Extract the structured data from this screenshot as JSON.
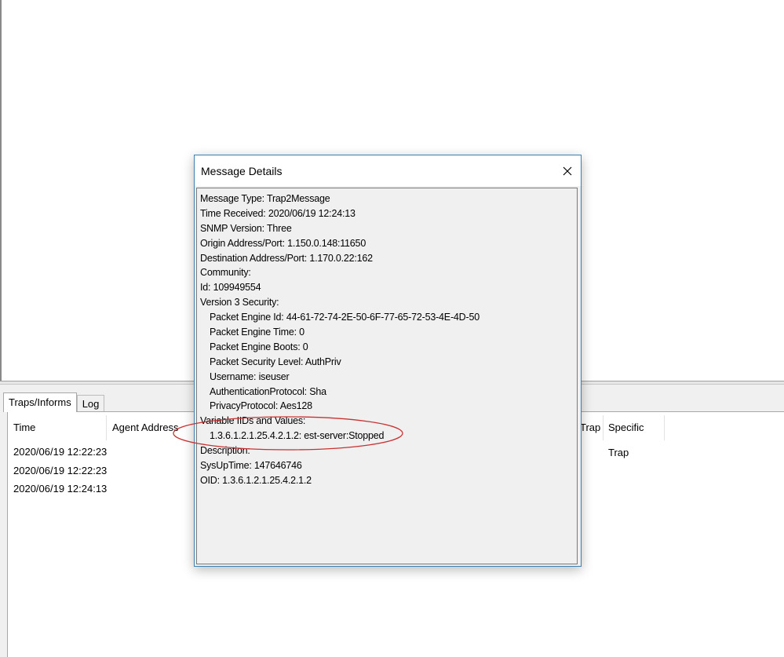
{
  "dialog": {
    "title": "Message Details",
    "lines": [
      {
        "text": "Message Type: Trap2Message",
        "indent": false
      },
      {
        "text": "Time Received: 2020/06/19 12:24:13",
        "indent": false
      },
      {
        "text": "SNMP Version: Three",
        "indent": false
      },
      {
        "text": "Origin Address/Port: 1.150.0.148:11650",
        "indent": false
      },
      {
        "text": "Destination Address/Port: 1.170.0.22:162",
        "indent": false
      },
      {
        "text": "Community:",
        "indent": false
      },
      {
        "text": "Id: 109949554",
        "indent": false
      },
      {
        "text": "Version 3 Security:",
        "indent": false
      },
      {
        "text": "Packet Engine Id: 44-61-72-74-2E-50-6F-77-65-72-53-4E-4D-50",
        "indent": true
      },
      {
        "text": "Packet Engine Time: 0",
        "indent": true
      },
      {
        "text": "Packet Engine Boots: 0",
        "indent": true
      },
      {
        "text": "Packet Security Level: AuthPriv",
        "indent": true
      },
      {
        "text": "Username: iseuser",
        "indent": true
      },
      {
        "text": "AuthenticationProtocol: Sha",
        "indent": true
      },
      {
        "text": "PrivacyProtocol: Aes128",
        "indent": true
      },
      {
        "text": "Variable IIDs and Values:",
        "indent": false
      },
      {
        "text": "1.3.6.1.2.1.25.4.2.1.2: est-server:Stopped",
        "indent": true
      },
      {
        "text": "Description:",
        "indent": false
      },
      {
        "text": "SysUpTime: 147646746",
        "indent": false
      },
      {
        "text": "OID: 1.3.6.1.2.1.25.4.2.1.2",
        "indent": false
      }
    ],
    "annotation_color": "#c83232"
  },
  "tabs": [
    "Traps/Informs",
    "Log"
  ],
  "active_tab": "Traps/Informs",
  "columns": [
    "Time",
    "Agent Address",
    "Trap",
    "Specific Trap"
  ],
  "rows": [
    {
      "time": "2020/06/19 12:22:23"
    },
    {
      "time": "2020/06/19 12:22:23"
    },
    {
      "time": "2020/06/19 12:24:13"
    }
  ],
  "icons": {
    "close": "close-icon"
  }
}
